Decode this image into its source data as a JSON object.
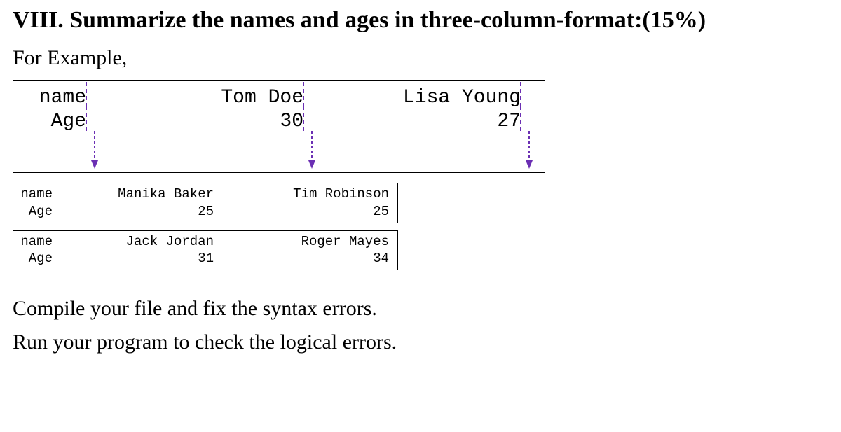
{
  "heading": "VIII. Summarize the names and ages in three-column-format:(15%)",
  "subheading": "For Example,",
  "example": {
    "row1": {
      "label": "name",
      "col2": "Tom Doe",
      "col3": "Lisa Young"
    },
    "row2": {
      "label": "Age",
      "col2": "30",
      "col3": "27"
    }
  },
  "output1": {
    "row1": {
      "label": "name",
      "col2": "Manika Baker",
      "col3": "Tim Robinson"
    },
    "row2": {
      "label": "Age",
      "col2": "25",
      "col3": "25"
    }
  },
  "output2": {
    "row1": {
      "label": "name",
      "col2": "Jack Jordan",
      "col3": "Roger Mayes"
    },
    "row2": {
      "label": "Age",
      "col2": "31",
      "col3": "34"
    }
  },
  "instruction1": "Compile your file and fix the syntax errors.",
  "instruction2": "Run your program to check the logical errors."
}
